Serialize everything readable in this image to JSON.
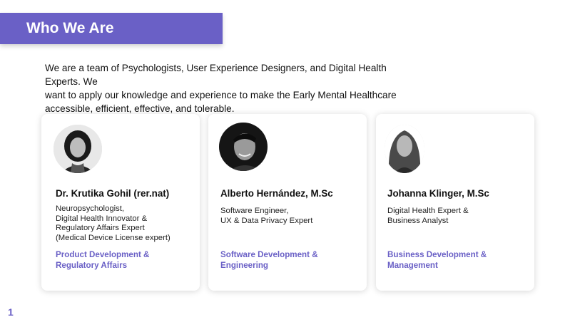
{
  "header": {
    "title": "Who We Are"
  },
  "intro": {
    "lines": [
      "We are a team of Psychologists, User Experience Designers, and Digital Health Experts. We",
      "want to apply our knowledge and experience to make the Early Mental Healthcare",
      "accessible, efficient, effective, and tolerable."
    ]
  },
  "team": [
    {
      "name": "Dr. Krutika Gohil (rer.nat)",
      "description": [
        "Neuropsychologist,",
        "Digital Health Innovator &",
        "Regulatory Affairs Expert",
        "(Medical Device License expert)"
      ],
      "department": [
        "Product Development &",
        "Regulatory Affairs"
      ]
    },
    {
      "name": "Alberto Hernández, M.Sc",
      "description": [
        "Software Engineer,",
        "UX & Data Privacy Expert"
      ],
      "department": [
        "Software Development &",
        "Engineering"
      ]
    },
    {
      "name": "Johanna Klinger, M.Sc",
      "description": [
        "Digital Health Expert &",
        "Business Analyst"
      ],
      "department": [
        "Business Development &",
        "Management"
      ]
    }
  ],
  "footer": {
    "page_number": "1"
  },
  "colors": {
    "accent": "#6a60c6",
    "text": "#111111",
    "card_bg": "#ffffff"
  }
}
